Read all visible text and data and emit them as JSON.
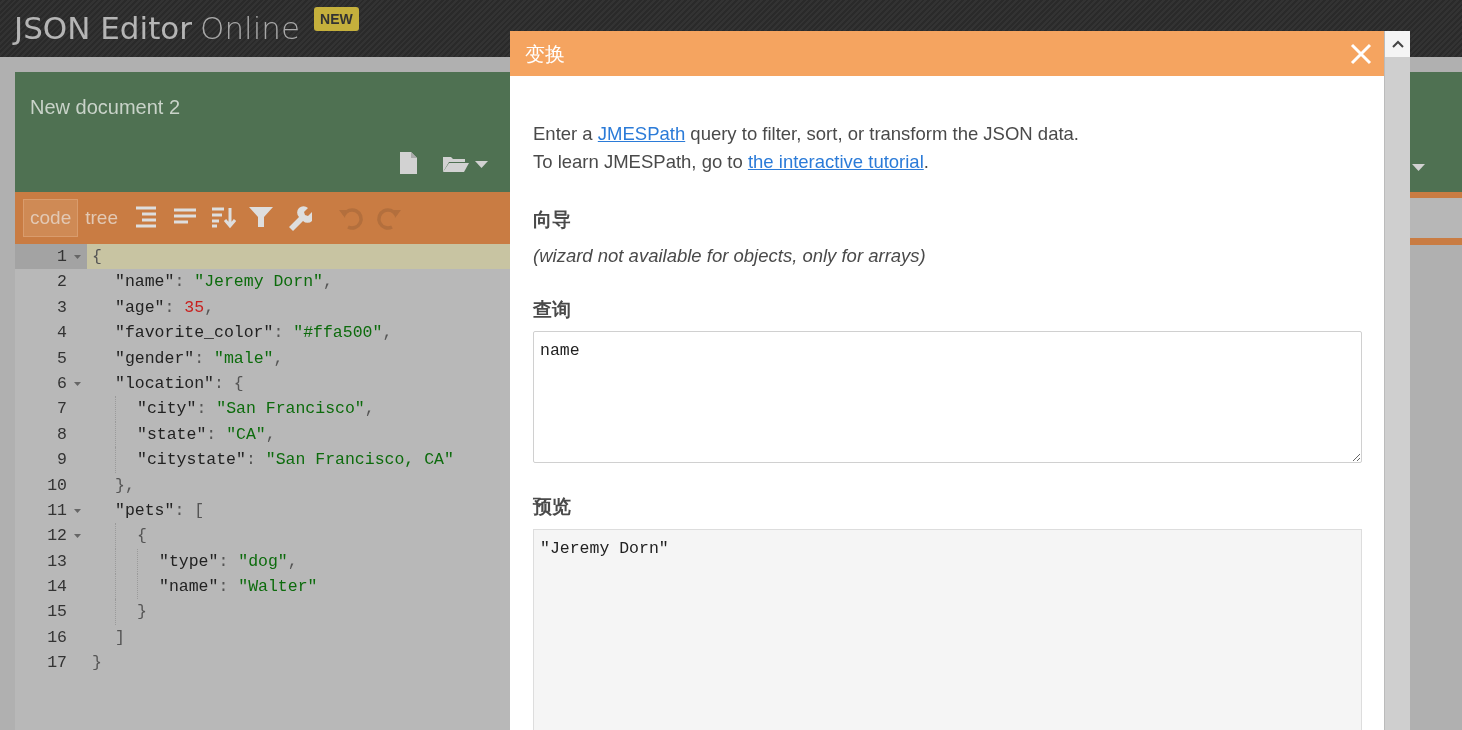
{
  "app": {
    "logo_primary": "JSON Editor",
    "logo_secondary": "Online",
    "badge": "NEW"
  },
  "left_panel": {
    "title": "New document 2",
    "modes": [
      {
        "label": "code",
        "selected": true
      },
      {
        "label": "tree",
        "selected": false
      }
    ],
    "tools": [
      {
        "kind": "format",
        "disabled": false
      },
      {
        "kind": "compact",
        "disabled": false
      },
      {
        "kind": "sort",
        "disabled": false
      },
      {
        "kind": "filter",
        "disabled": false
      },
      {
        "kind": "repair",
        "disabled": false
      },
      {
        "kind": "undo",
        "disabled": true
      },
      {
        "kind": "redo",
        "disabled": true
      }
    ],
    "lines": [
      {
        "number": "1",
        "fold": true,
        "active": true,
        "tokens": [
          {
            "kind": "punct",
            "text": "{"
          }
        ],
        "children": [
          {
            "number": "2",
            "fold": false,
            "active": false,
            "tokens": [
              {
                "kind": "key",
                "text": "\"name\""
              },
              {
                "kind": "punct",
                "text": ": "
              },
              {
                "kind": "string",
                "text": "\"Jeremy Dorn\""
              },
              {
                "kind": "punct",
                "text": ","
              }
            ]
          },
          {
            "number": "3",
            "fold": false,
            "active": false,
            "tokens": [
              {
                "kind": "key",
                "text": "\"age\""
              },
              {
                "kind": "punct",
                "text": ": "
              },
              {
                "kind": "number",
                "text": "35"
              },
              {
                "kind": "punct",
                "text": ","
              }
            ]
          },
          {
            "number": "4",
            "fold": false,
            "active": false,
            "tokens": [
              {
                "kind": "key",
                "text": "\"favorite_color\""
              },
              {
                "kind": "punct",
                "text": ": "
              },
              {
                "kind": "string",
                "text": "\"#ffa500\""
              },
              {
                "kind": "punct",
                "text": ","
              }
            ]
          },
          {
            "number": "5",
            "fold": false,
            "active": false,
            "tokens": [
              {
                "kind": "key",
                "text": "\"gender\""
              },
              {
                "kind": "punct",
                "text": ": "
              },
              {
                "kind": "string",
                "text": "\"male\""
              },
              {
                "kind": "punct",
                "text": ","
              }
            ]
          },
          {
            "number": "6",
            "fold": true,
            "active": false,
            "tokens": [
              {
                "kind": "key",
                "text": "\"location\""
              },
              {
                "kind": "punct",
                "text": ": {"
              }
            ],
            "children": [
              {
                "number": "7",
                "fold": false,
                "active": false,
                "tokens": [
                  {
                    "kind": "key",
                    "text": "\"city\""
                  },
                  {
                    "kind": "punct",
                    "text": ": "
                  },
                  {
                    "kind": "string",
                    "text": "\"San Francisco\""
                  },
                  {
                    "kind": "punct",
                    "text": ","
                  }
                ]
              },
              {
                "number": "8",
                "fold": false,
                "active": false,
                "tokens": [
                  {
                    "kind": "key",
                    "text": "\"state\""
                  },
                  {
                    "kind": "punct",
                    "text": ": "
                  },
                  {
                    "kind": "string",
                    "text": "\"CA\""
                  },
                  {
                    "kind": "punct",
                    "text": ","
                  }
                ]
              },
              {
                "number": "9",
                "fold": false,
                "active": false,
                "tokens": [
                  {
                    "kind": "key",
                    "text": "\"citystate\""
                  },
                  {
                    "kind": "punct",
                    "text": ": "
                  },
                  {
                    "kind": "string",
                    "text": "\"San Francisco, CA\""
                  }
                ]
              }
            ]
          },
          {
            "number": "10",
            "fold": false,
            "active": false,
            "tokens": [
              {
                "kind": "punct",
                "text": "},"
              }
            ]
          },
          {
            "number": "11",
            "fold": true,
            "active": false,
            "tokens": [
              {
                "kind": "key",
                "text": "\"pets\""
              },
              {
                "kind": "punct",
                "text": ": ["
              }
            ],
            "children": [
              {
                "number": "12",
                "fold": true,
                "active": false,
                "tokens": [
                  {
                    "kind": "punct",
                    "text": "{"
                  }
                ],
                "children": [
                  {
                    "number": "13",
                    "fold": false,
                    "active": false,
                    "tokens": [
                      {
                        "kind": "key",
                        "text": "\"type\""
                      },
                      {
                        "kind": "punct",
                        "text": ": "
                      },
                      {
                        "kind": "string",
                        "text": "\"dog\""
                      },
                      {
                        "kind": "punct",
                        "text": ","
                      }
                    ]
                  },
                  {
                    "number": "14",
                    "fold": false,
                    "active": false,
                    "tokens": [
                      {
                        "kind": "key",
                        "text": "\"name\""
                      },
                      {
                        "kind": "punct",
                        "text": ": "
                      },
                      {
                        "kind": "string",
                        "text": "\"Walter\""
                      }
                    ]
                  }
                ]
              },
              {
                "number": "15",
                "fold": false,
                "active": false,
                "tokens": [
                  {
                    "kind": "punct",
                    "text": "}"
                  }
                ]
              }
            ]
          },
          {
            "number": "16",
            "fold": false,
            "active": false,
            "tokens": [
              {
                "kind": "punct",
                "text": "]"
              }
            ]
          }
        ]
      },
      {
        "number": "17",
        "fold": false,
        "active": false,
        "tokens": [
          {
            "kind": "punct",
            "text": "}"
          }
        ]
      }
    ]
  },
  "modal": {
    "title": "变换",
    "intro": [
      [
        {
          "text": "Enter a "
        },
        {
          "text": "JMESPath",
          "link": true
        },
        {
          "text": " query to filter, sort, or transform the JSON data."
        }
      ],
      [
        {
          "text": "To learn JMESPath, go to "
        },
        {
          "text": "the interactive tutorial",
          "link": true
        },
        {
          "text": "."
        }
      ]
    ],
    "wizard": {
      "heading": "向导",
      "note": "(wizard not available for objects, only for arrays)"
    },
    "query": {
      "heading": "查询",
      "value": "name"
    },
    "preview": {
      "heading": "预览",
      "value": "\"Jeremy Dorn\""
    }
  }
}
